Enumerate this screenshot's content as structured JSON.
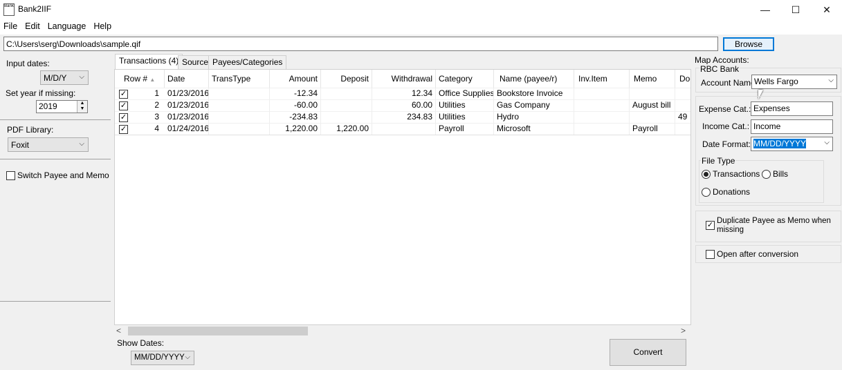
{
  "window": {
    "icon_text": "Bank",
    "title": "Bank2IIF",
    "minimize_glyph": "—",
    "maximize_glyph": "☐",
    "close_glyph": "✕"
  },
  "menu": [
    "File",
    "Edit",
    "Language",
    "Help"
  ],
  "path": {
    "value": "C:\\Users\\serg\\Downloads\\sample.qif",
    "browse_label": "Browse"
  },
  "left": {
    "input_dates_label": "Input dates:",
    "input_dates_value": "M/D/Y",
    "year_label": "Set year if missing:",
    "year_value": "2019",
    "pdf_label": "PDF Library:",
    "pdf_value": "Foxit",
    "switch_label": "Switch Payee and Memo"
  },
  "tabs": [
    "Transactions (4)",
    "Source",
    "Payees/Categories"
  ],
  "grid": {
    "columns": [
      "Row #",
      "Date",
      "TransType",
      "Amount",
      "Deposit",
      "Withdrawal",
      "Category",
      "Name (payee/r)",
      "Inv.Item",
      "Memo",
      "Doc"
    ],
    "rows": [
      [
        "1",
        "01/23/2016",
        "",
        "-12.34",
        "",
        "12.34",
        "Office Supplies",
        "Bookstore Invoice",
        "",
        "",
        ""
      ],
      [
        "2",
        "01/23/2016",
        "",
        "-60.00",
        "",
        "60.00",
        "Utilities",
        "Gas Company",
        "",
        "August bill",
        ""
      ],
      [
        "3",
        "01/23/2016",
        "",
        "-234.83",
        "",
        "234.83",
        "Utilities",
        "Hydro",
        "",
        "",
        "49"
      ],
      [
        "4",
        "01/24/2016",
        "",
        "1,220.00",
        "1,220.00",
        "",
        "Payroll",
        "Microsoft",
        "",
        "Payroll",
        ""
      ]
    ]
  },
  "bottom": {
    "show_dates_label": "Show Dates:",
    "show_dates_value": "MM/DD/YYYY",
    "convert_label": "Convert"
  },
  "right": {
    "map_accounts_label": "Map Accounts:",
    "bank_label": "RBC Bank",
    "account_name_label": "Account Name:",
    "account_name_value": "Wells Fargo",
    "expense_label": "Expense Cat.:",
    "expense_value": "Expenses",
    "income_label": "Income Cat.:",
    "income_value": "Income",
    "date_format_label": "Date Format:",
    "date_format_value": "MM/DD/YYYY",
    "file_type_label": "File Type",
    "file_types": [
      "Transactions",
      "Bills",
      "Donations"
    ],
    "duplicate_label": "Duplicate Payee as Memo when missing",
    "open_after_label": "Open after conversion"
  },
  "colors": {
    "accent": "#0078d7",
    "selection": "#0078d7"
  }
}
